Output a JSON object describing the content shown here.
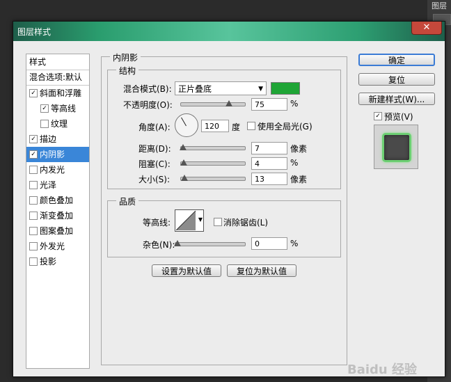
{
  "app_strip": {
    "label": "图层"
  },
  "dialog": {
    "title": "图层样式",
    "close": "✕"
  },
  "style_list": {
    "header": "样式",
    "blend_options": "混合选项:默认",
    "items": [
      {
        "label": "斜面和浮雕",
        "checked": "✓"
      },
      {
        "label": "等高线",
        "checked": "✓"
      },
      {
        "label": "纹理",
        "checked": ""
      },
      {
        "label": "描边",
        "checked": "✓"
      },
      {
        "label": "内阴影",
        "checked": "✓"
      },
      {
        "label": "内发光",
        "checked": ""
      },
      {
        "label": "光泽",
        "checked": ""
      },
      {
        "label": "颜色叠加",
        "checked": ""
      },
      {
        "label": "渐变叠加",
        "checked": ""
      },
      {
        "label": "图案叠加",
        "checked": ""
      },
      {
        "label": "外发光",
        "checked": ""
      },
      {
        "label": "投影",
        "checked": ""
      }
    ]
  },
  "panel": {
    "title": "内阴影",
    "structure": {
      "title": "结构",
      "blend_mode_label": "混合模式(B):",
      "blend_mode_value": "正片叠底",
      "color": "#1fa536",
      "opacity_label": "不透明度(O):",
      "opacity_value": "75",
      "opacity_unit": "%",
      "angle_label": "角度(A):",
      "angle_value": "120",
      "angle_unit": "度",
      "global_light_label": "使用全局光(G)",
      "distance_label": "距离(D):",
      "distance_value": "7",
      "distance_unit": "像素",
      "choke_label": "阻塞(C):",
      "choke_value": "4",
      "choke_unit": "%",
      "size_label": "大小(S):",
      "size_value": "13",
      "size_unit": "像素"
    },
    "quality": {
      "title": "品质",
      "contour_label": "等高线:",
      "antialias_label": "消除锯齿(L)",
      "noise_label": "杂色(N):",
      "noise_value": "0",
      "noise_unit": "%"
    },
    "make_default": "设置为默认值",
    "reset_default": "复位为默认值"
  },
  "buttons": {
    "ok": "确定",
    "reset": "复位",
    "new_style": "新建样式(W)...",
    "preview_label": "预览(V)",
    "preview_checked": "✓"
  },
  "watermark": "Baidu 经验"
}
